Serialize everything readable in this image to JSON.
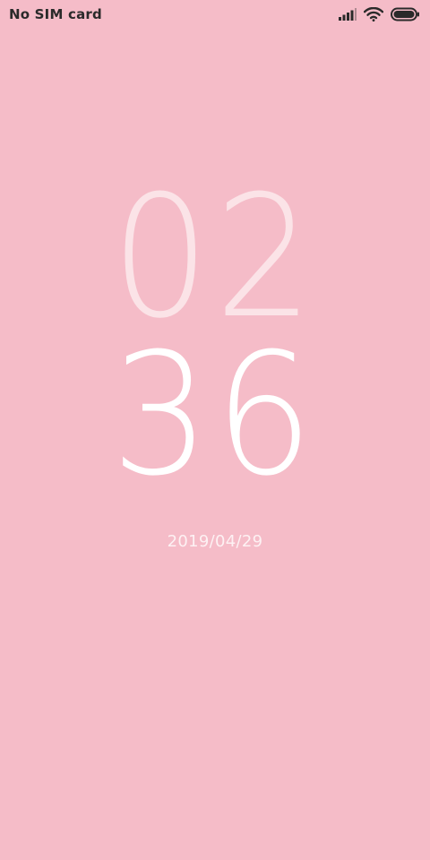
{
  "status_bar": {
    "carrier": "No SIM card",
    "icons": [
      "signal-icon",
      "wifi-icon",
      "battery-icon"
    ]
  },
  "lock_screen": {
    "hours": "02",
    "minutes": "36",
    "date": "2019/04/29"
  },
  "colors": {
    "background": "#F5BCC8",
    "hours_text": "#FBE3E7",
    "minutes_text": "#FFFFFF",
    "date_text": "#FDF1F3"
  }
}
